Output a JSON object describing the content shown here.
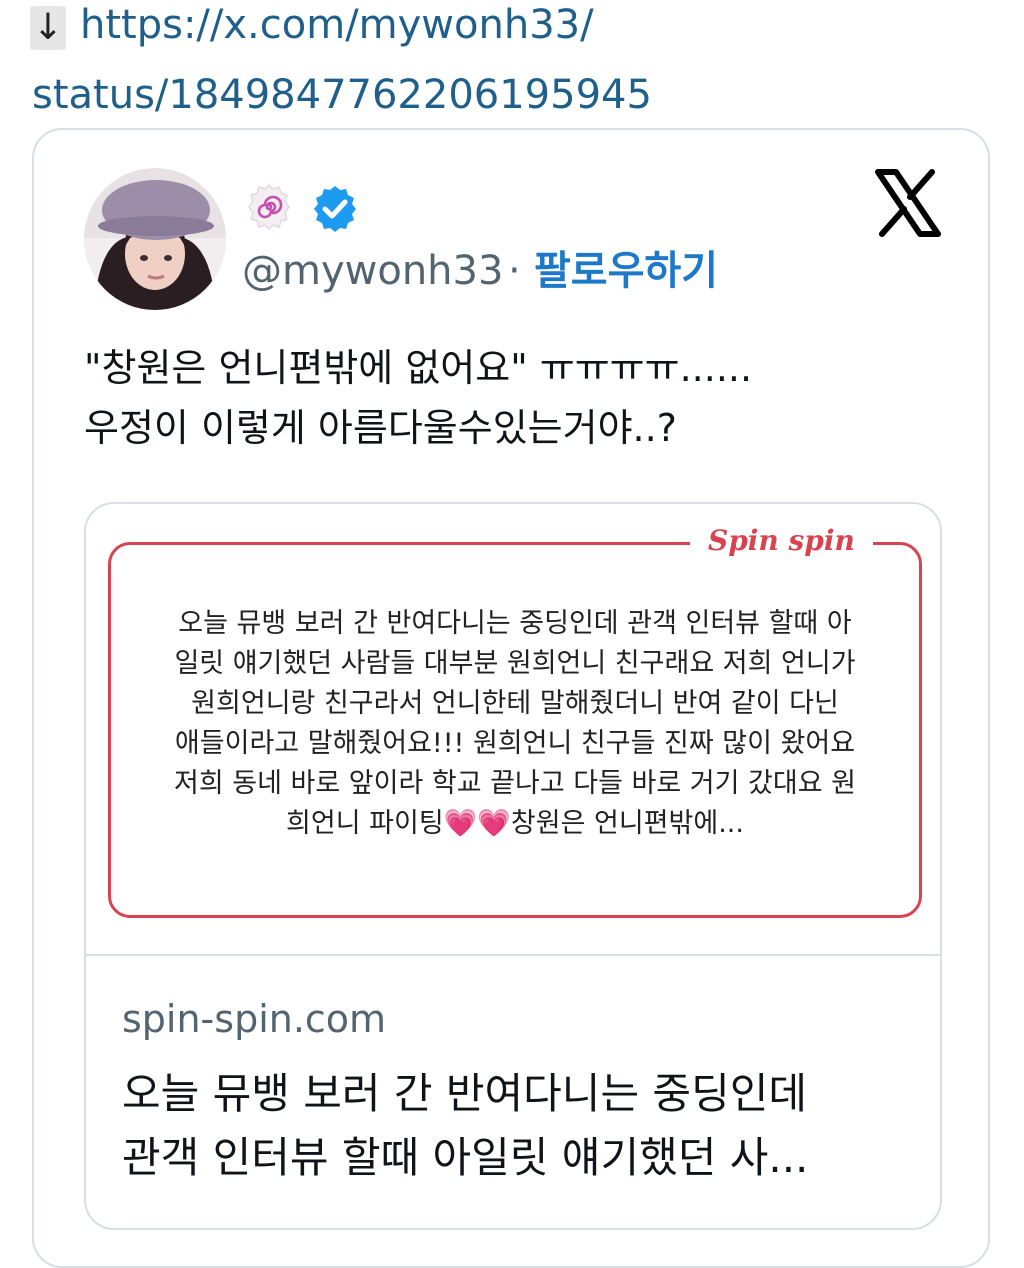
{
  "link": {
    "url_line1": "https://x.com/mywonh33/",
    "url_line2": "status/1849847762206195945",
    "arrow_glyph": "↓"
  },
  "tweet": {
    "handle": "@mywonh33",
    "separator": "·",
    "follow_label": "팔로우하기",
    "text_lines": [
      "\"창원은 언니편밖에 없어요\" ㅠㅠㅠㅠ......",
      "우정이 이렇게 아름다울수있는거야..?"
    ]
  },
  "link_card": {
    "preview": {
      "brand": "Spin spin",
      "lines": [
        "오늘 뮤뱅 보러 간 반여다니는 중딩인데 관객 인터뷰 할때 아",
        "일릿 얘기했던 사람들 대부분 원희언니 친구래요 저희 언니가",
        "원희언니랑 친구라서 언니한테 말해줬더니 반여 같이 다닌",
        "애들이라고 말해줬어요!!! 원희언니 친구들 진짜 많이 왔어요",
        "저희 동네 바로 앞이라 학교 끝나고 다들 바로 거기 갔대요 원",
        "희언니 파이팅💗💗창원은 언니편밖에..."
      ]
    },
    "domain": "spin-spin.com",
    "title_lines": [
      "오늘 뮤뱅 보러 간 반여다니는 중딩인데",
      "관객 인터뷰 할때 아일릿 얘기했던 사..."
    ]
  },
  "colors": {
    "link_blue": "#1f5f8b",
    "follow_blue": "#1d78c9",
    "verified_blue": "#1d9bf0",
    "brand_red": "#d9434f",
    "muted_gray": "#536471"
  },
  "icons": [
    "down-arrow-icon",
    "affiliate-badge-icon",
    "verified-badge-icon",
    "x-logo-icon"
  ]
}
